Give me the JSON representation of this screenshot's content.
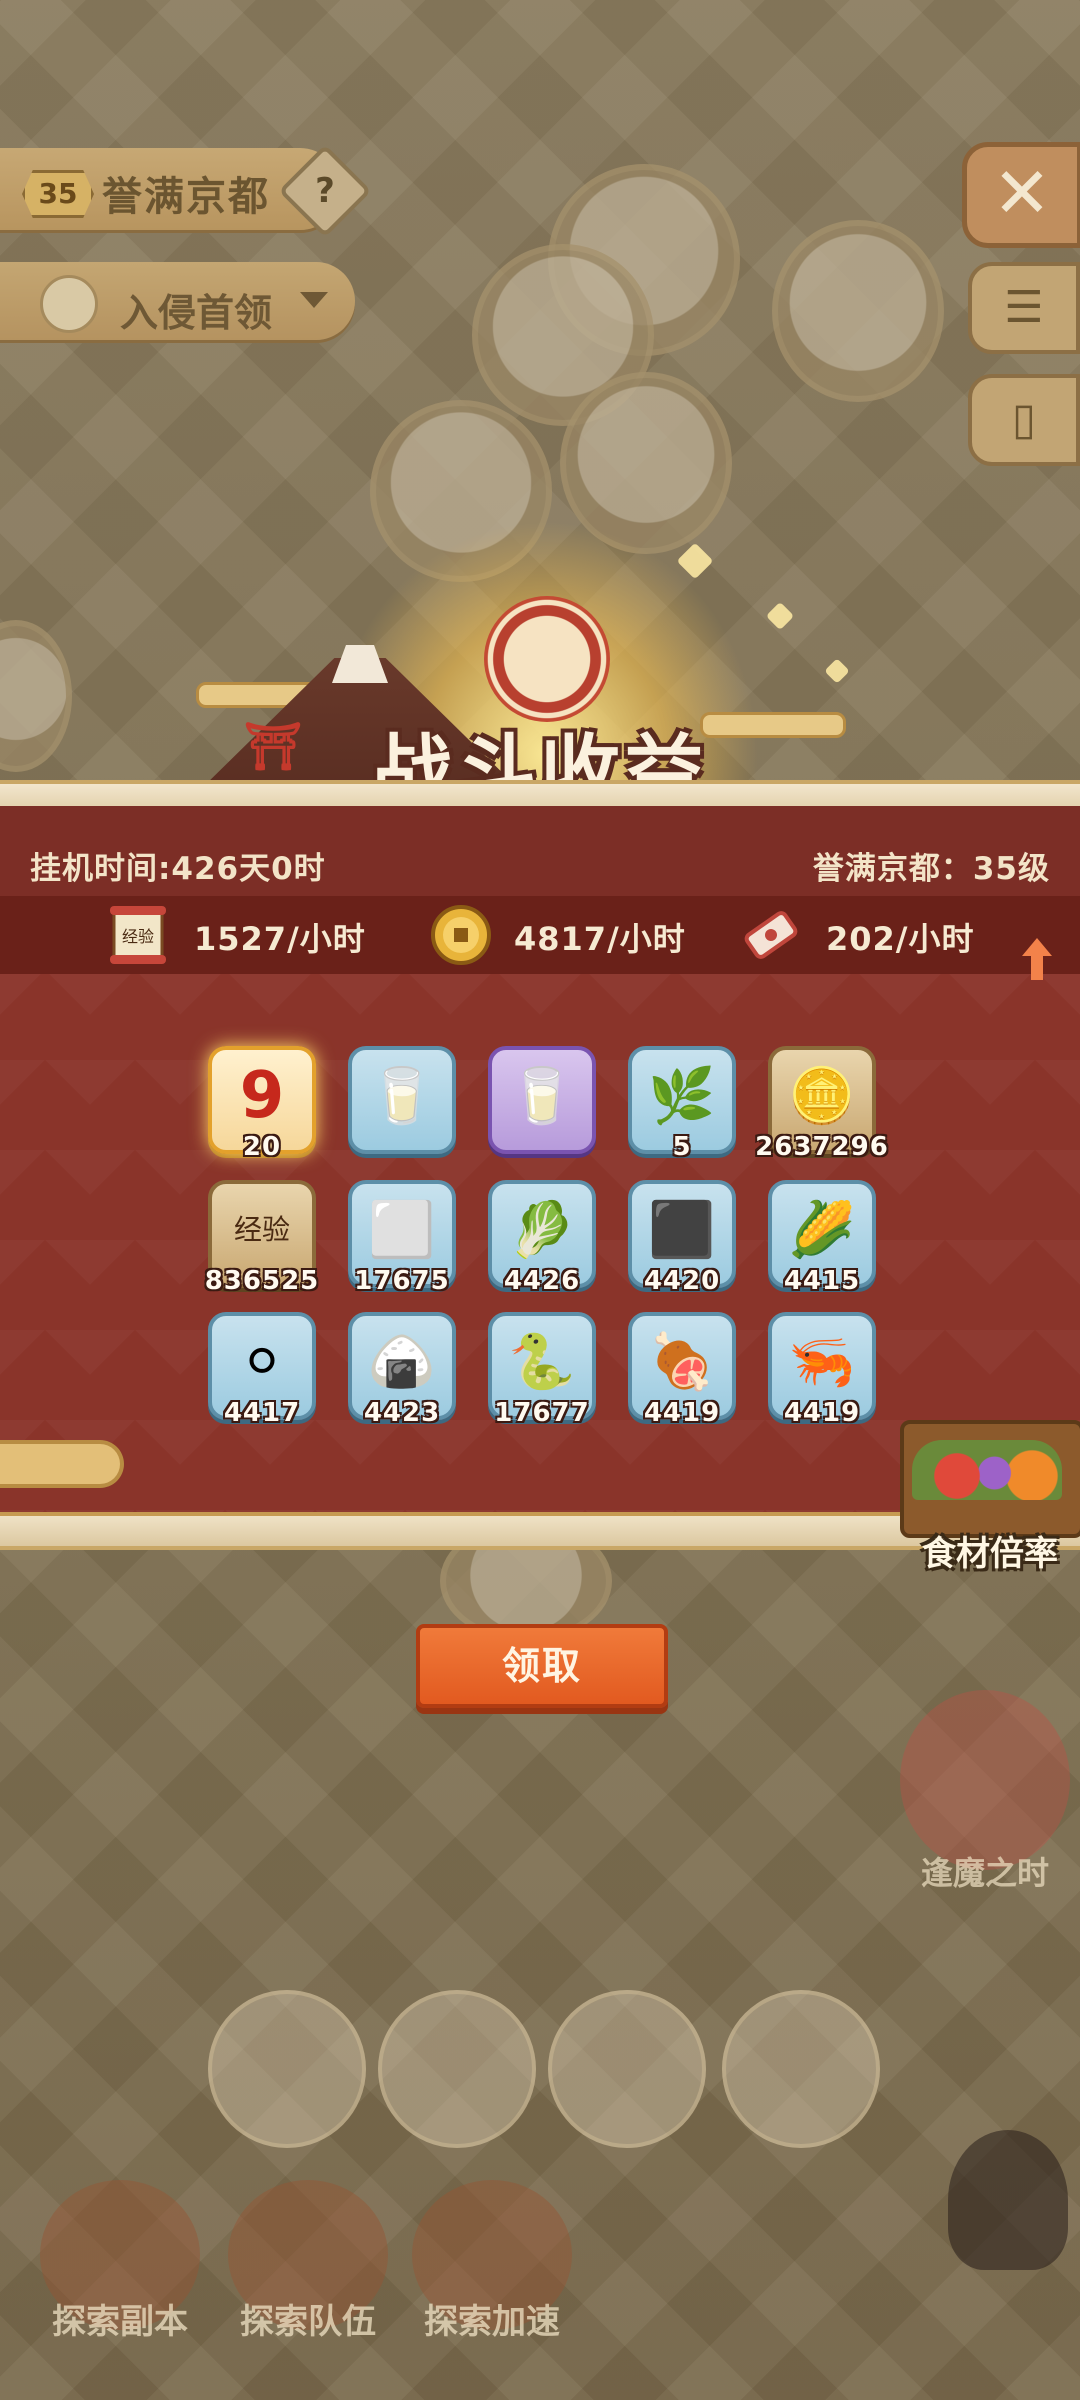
{
  "map": {
    "area_level": "35",
    "area_name": "誉满京都",
    "help_icon": "?",
    "boss_label": "入侵首领"
  },
  "side": {
    "close_icon": "✕",
    "list_icon": "☰",
    "card_icon": "▯"
  },
  "banner": {
    "title": "战斗收益"
  },
  "summary": {
    "idle_time": "挂机时间:426天0时",
    "area_level": "誉满京都：35级",
    "rates": [
      {
        "icon": "exp-scroll-icon",
        "text": "1527/小时"
      },
      {
        "icon": "coin-icon",
        "text": "4817/小时"
      },
      {
        "icon": "ticket-icon",
        "text": "202/小时"
      }
    ]
  },
  "items": [
    {
      "name": "red-nine-token",
      "glyph": "9",
      "count": "20",
      "frame": "gold"
    },
    {
      "name": "milk-carton-blue",
      "glyph": "🥛",
      "count": "",
      "frame": "blue"
    },
    {
      "name": "milk-carton-purple",
      "glyph": "🥛",
      "count": "",
      "frame": "purple"
    },
    {
      "name": "green-leaf",
      "glyph": "🌿",
      "count": "5",
      "frame": "blue"
    },
    {
      "name": "gold-coin",
      "glyph": "🪙",
      "count": "2637296",
      "frame": "brown"
    },
    {
      "name": "exp-scroll",
      "glyph": "经验",
      "count": "836525",
      "frame": "brown"
    },
    {
      "name": "tofu",
      "glyph": "⬜",
      "count": "17675",
      "frame": "blue"
    },
    {
      "name": "bok-choy",
      "glyph": "🥬",
      "count": "4426",
      "frame": "blue"
    },
    {
      "name": "seaweed",
      "glyph": "⬛",
      "count": "4420",
      "frame": "blue"
    },
    {
      "name": "corn",
      "glyph": "🌽",
      "count": "4415",
      "frame": "blue"
    },
    {
      "name": "egg",
      "glyph": "⚪",
      "count": "4417",
      "frame": "blue"
    },
    {
      "name": "rice-balls",
      "glyph": "🍙",
      "count": "4423",
      "frame": "blue"
    },
    {
      "name": "eel",
      "glyph": "🐍",
      "count": "17677",
      "frame": "blue"
    },
    {
      "name": "meat",
      "glyph": "🍖",
      "count": "4419",
      "frame": "blue"
    },
    {
      "name": "shrimp",
      "glyph": "🦐",
      "count": "4419",
      "frame": "blue"
    }
  ],
  "ingredient_rate_label": "食材倍率",
  "claim_label": "领取",
  "demon_label": "逢魔之时",
  "nav": {
    "explore_dungeon": "探索副本",
    "explore_team": "探索队伍",
    "explore_speed": "探索加速"
  },
  "colors": {
    "panel": "#7c2e26",
    "rate_bar": "#6a2119",
    "claim": "#e8642a"
  }
}
